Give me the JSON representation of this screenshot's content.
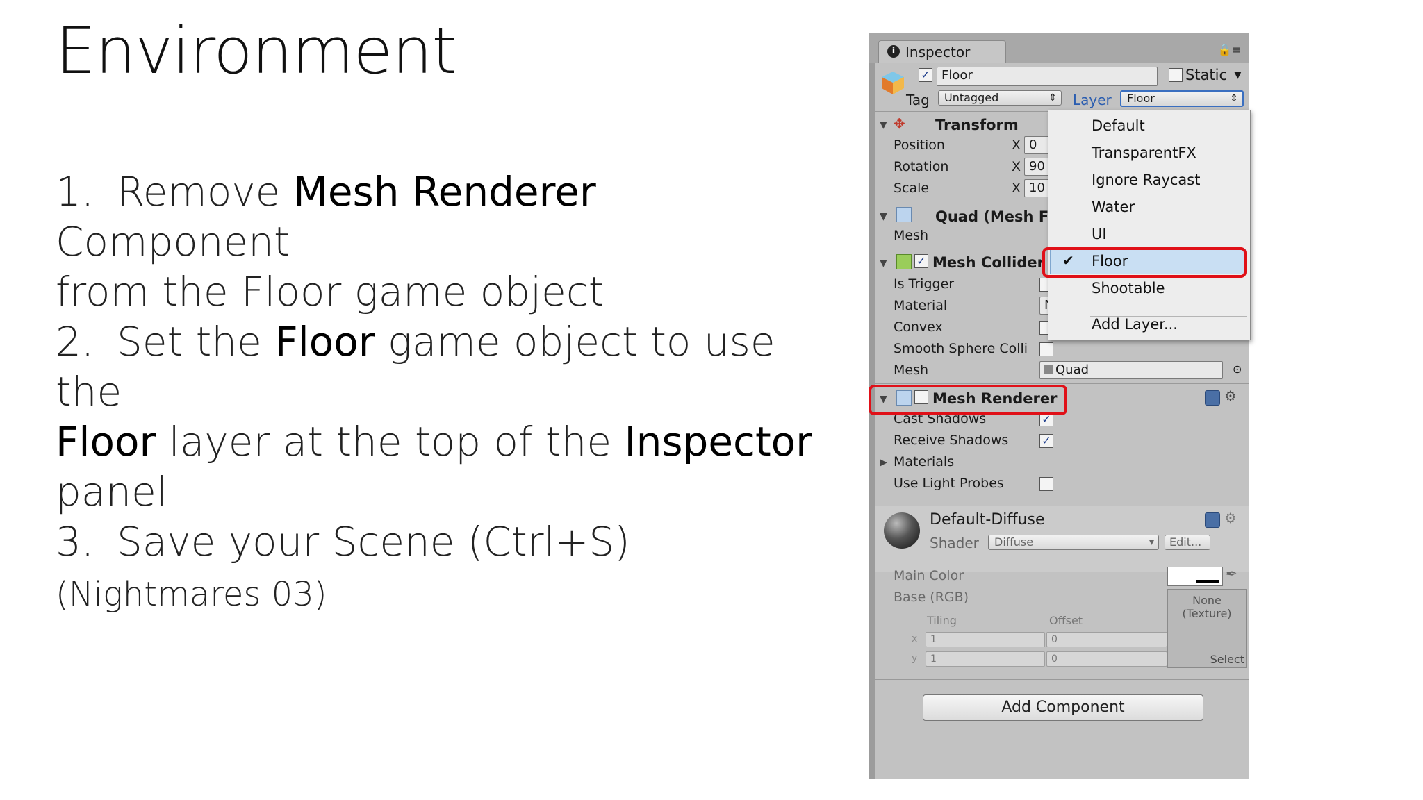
{
  "slide": {
    "title": "Environment",
    "step1": {
      "num": "1.",
      "a": "Remove ",
      "b": "Mesh Renderer",
      "c": " Component",
      "d": "from the Floor game object"
    },
    "step2": {
      "num": "2.",
      "a": "Set the ",
      "b": "Floor",
      "c": " game object to use the",
      "d": "Floor",
      "e": " layer at the top of the ",
      "f": "Inspector",
      "g": " panel"
    },
    "step3": {
      "num": "3.",
      "a": "Save your Scene (Ctrl+S) ",
      "b": "(Nightmares 03)"
    }
  },
  "inspector": {
    "tab_label": "Inspector",
    "tab_icon": "info-icon",
    "object_name": "Floor",
    "object_active": true,
    "static_label": "Static",
    "static_checked": false,
    "tag_label": "Tag",
    "tag_value": "Untagged",
    "layer_label": "Layer",
    "layer_value": "Floor",
    "transform": {
      "title": "Transform",
      "position_label": "Position",
      "position_x": "0",
      "rotation_label": "Rotation",
      "rotation_x": "90",
      "scale_label": "Scale",
      "scale_x": "10",
      "x_label": "X"
    },
    "quad": {
      "title": "Quad (Mesh Fi",
      "mesh_label": "Mesh"
    },
    "mesh_collider": {
      "title": "Mesh Collider",
      "enabled": true,
      "is_trigger_label": "Is Trigger",
      "material_label": "Material",
      "material_value": "N",
      "convex_label": "Convex",
      "smooth_label": "Smooth Sphere Colli",
      "mesh_label": "Mesh",
      "mesh_value": "Quad"
    },
    "mesh_renderer": {
      "title": "Mesh Renderer",
      "enabled": false,
      "cast_shadows_label": "Cast Shadows",
      "cast_shadows": true,
      "receive_shadows_label": "Receive Shadows",
      "receive_shadows": true,
      "materials_label": "Materials",
      "light_probes_label": "Use Light Probes",
      "light_probes": false
    },
    "material": {
      "name": "Default-Diffuse",
      "shader_label": "Shader",
      "shader_value": "Diffuse",
      "edit_label": "Edit...",
      "main_color_label": "Main Color",
      "base_label": "Base (RGB)",
      "texture_none": "None",
      "texture_type": "(Texture)",
      "select_label": "Select",
      "tiling_label": "Tiling",
      "offset_label": "Offset",
      "x_axis": "x",
      "y_axis": "y",
      "tiling_x": "1",
      "tiling_y": "1",
      "offset_x": "0",
      "offset_y": "0"
    },
    "add_component_label": "Add Component"
  },
  "layer_menu": {
    "items": [
      "Default",
      "TransparentFX",
      "Ignore Raycast",
      "Water",
      "UI",
      "Floor",
      "Shootable",
      "Add Layer..."
    ],
    "selected": "Floor"
  },
  "colors": {
    "highlight": "#e01018",
    "panel": "#c2c2c2",
    "layer_label": "#2a5db0"
  }
}
